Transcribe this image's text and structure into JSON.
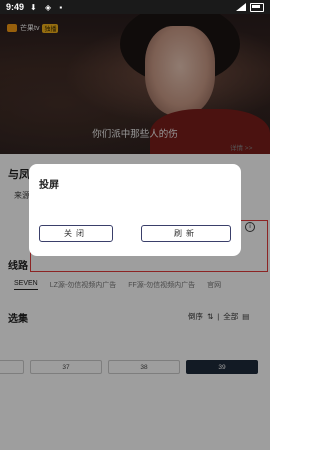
{
  "status_bar": {
    "time": "9:49",
    "icons": [
      "download-icon",
      "shield-icon",
      "sim-icon"
    ]
  },
  "video": {
    "logo_text": "芒果tv",
    "logo_badge": "独播",
    "subtitle": "你们派中那些人的伤"
  },
  "page": {
    "title": "与凤行",
    "detail_link": "详情 >>",
    "desc": "来源",
    "route_heading": "线路",
    "routes": [
      "SEVEN",
      "LZ源-勿信视频内广告",
      "FF源-勿信视频内广告",
      "官网"
    ],
    "episode_heading": "选集",
    "episode_order": "倒序",
    "episode_all": "全部",
    "episodes": [
      "",
      "37",
      "38",
      "39"
    ]
  },
  "dialog": {
    "title": "投屏",
    "close_label": "关闭",
    "refresh_label": "刷新"
  },
  "colors": {
    "accent": "#1e2a3a",
    "highlight_box": "#e23a3a",
    "dialog_button_border": "#3a3f6a"
  }
}
